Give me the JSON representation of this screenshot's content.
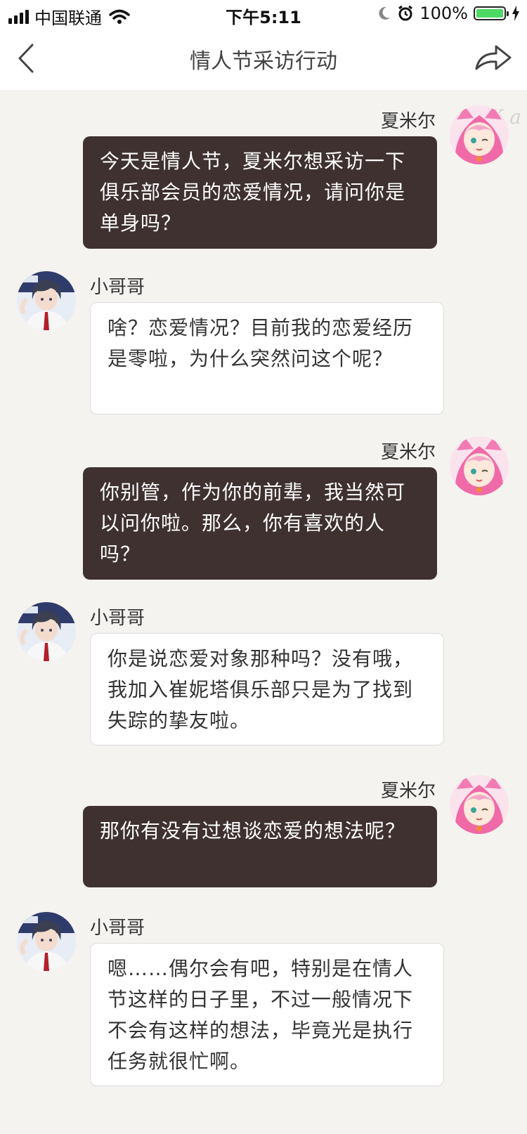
{
  "status_bar": {
    "carrier": "中国联通",
    "time": "下午5:11",
    "battery": "100%",
    "battery_level": 1.0
  },
  "nav": {
    "title": "情人节采访行动"
  },
  "watermark": "K    a",
  "messages": [
    {
      "sender": "夏米尔",
      "side": "right",
      "text": "今天是情人节，夏米尔想采访一下俱乐部会员的恋爱情况，请问你是单身吗？"
    },
    {
      "sender": "小哥哥",
      "side": "left",
      "text": "啥？恋爱情况？目前我的恋爱经历是零啦，为什么突然问这个呢？"
    },
    {
      "sender": "夏米尔",
      "side": "right",
      "text": "你别管，作为你的前辈，我当然可以问你啦。那么，你有喜欢的人吗？"
    },
    {
      "sender": "小哥哥",
      "side": "left",
      "text": "你是说恋爱对象那种吗？没有哦，我加入崔妮塔俱乐部只是为了找到失踪的挚友啦。"
    },
    {
      "sender": "夏米尔",
      "side": "right",
      "text": "那你有没有过想谈恋爱的想法呢？"
    },
    {
      "sender": "小哥哥",
      "side": "left",
      "text": "嗯……偶尔会有吧，特别是在情人节这样的日子里，不过一般情况下不会有这样的想法，毕竟光是执行任务就很忙啊。"
    }
  ]
}
